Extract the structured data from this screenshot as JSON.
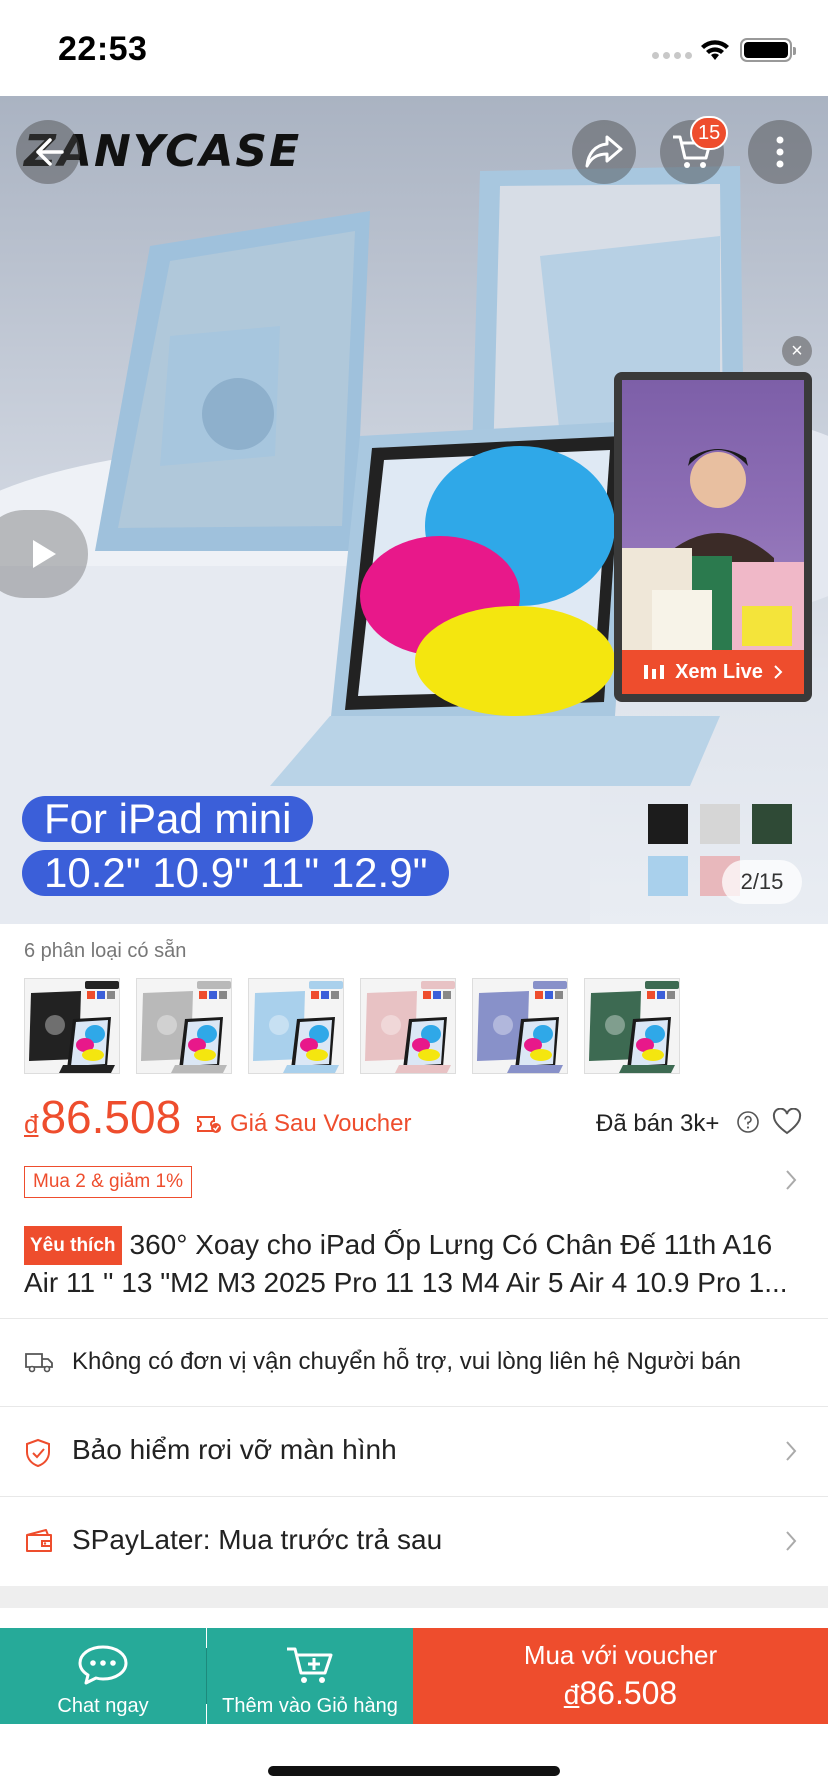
{
  "status_bar": {
    "time": "22:53"
  },
  "hero": {
    "brand": "ZANYCASE",
    "cart_count": "15",
    "pill_line_1": "For iPad mini",
    "pill_line_2": "10.2\" 10.9\" 11\" 12.9\"",
    "image_counter": "2/15",
    "live_label": "Xem Live",
    "swatch_colors": [
      "#1c1c1c",
      "#d6d6d6",
      "#2f4a36",
      "#a9d0ec",
      "#e8b8bc"
    ]
  },
  "variants": {
    "count_label": "6 phân loại có sẵn",
    "items": [
      {
        "tag": "Black",
        "case_color": "#222222"
      },
      {
        "tag": "Grey",
        "case_color": "#b9b9b9"
      },
      {
        "tag": "Sky blue",
        "case_color": "#a9d0ec"
      },
      {
        "tag": "Pink",
        "case_color": "#e8c2c4"
      },
      {
        "tag": "Purple",
        "case_color": "#8891c9"
      },
      {
        "tag": "Dark green",
        "case_color": "#3d6a52"
      }
    ]
  },
  "price": {
    "currency": "đ",
    "amount": "86.508",
    "voucher_label": "Giá Sau Voucher",
    "sold": "Đã bán 3k+"
  },
  "promo": {
    "label": "Mua 2 & giảm 1%"
  },
  "product": {
    "badge": "Yêu thích",
    "title": "360° Xoay cho iPad Ốp Lưng Có Chân Đế 11th A16 Air 11 '' 13 \"M2 M3 2025 Pro 11 13 M4 Air 5 Air 4 10.9 Pro 1..."
  },
  "info_rows": {
    "shipping": "Không có đơn vị vận chuyển hỗ trợ, vui lòng liên hệ Người bán",
    "insurance": "Bảo hiểm rơi vỡ màn hình",
    "spaylater": "SPayLater: Mua trước trả sau"
  },
  "bottom_bar": {
    "chat": "Chat ngay",
    "add_to_cart": "Thêm vào Giỏ hàng",
    "buy_line_1": "Mua với voucher",
    "buy_currency": "đ",
    "buy_amount": "86.508"
  }
}
